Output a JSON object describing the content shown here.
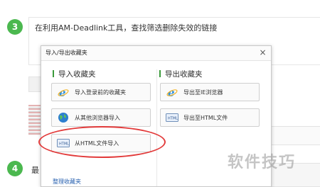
{
  "step3": {
    "number": "3",
    "text": "在利用AM-Deadlink工具，查找筛选删除失效的链接"
  },
  "step4": {
    "number": "4",
    "text_fragment": "最"
  },
  "dialog": {
    "title": "导入/导出收藏夹",
    "close_glyph": "×",
    "import_section": {
      "title": "导入收藏夹",
      "buttons": [
        {
          "label": "导入登录前的收藏夹",
          "icon": "ie-icon"
        },
        {
          "label": "从其他浏览器导入",
          "icon": "globe-icon"
        },
        {
          "label": "从HTML文件导入",
          "icon": "html-file-icon"
        }
      ]
    },
    "export_section": {
      "title": "导出收藏夹",
      "buttons": [
        {
          "label": "导出至IE浏览器",
          "icon": "ie-icon"
        },
        {
          "label": "导出至HTML文件",
          "icon": "html-file-icon"
        }
      ]
    },
    "footer_link": "整理收藏夹"
  },
  "watermark": "软件技巧",
  "colors": {
    "accent_green": "#4bb84f",
    "highlight_red": "#e23a3a",
    "link_blue": "#2a62b0"
  }
}
